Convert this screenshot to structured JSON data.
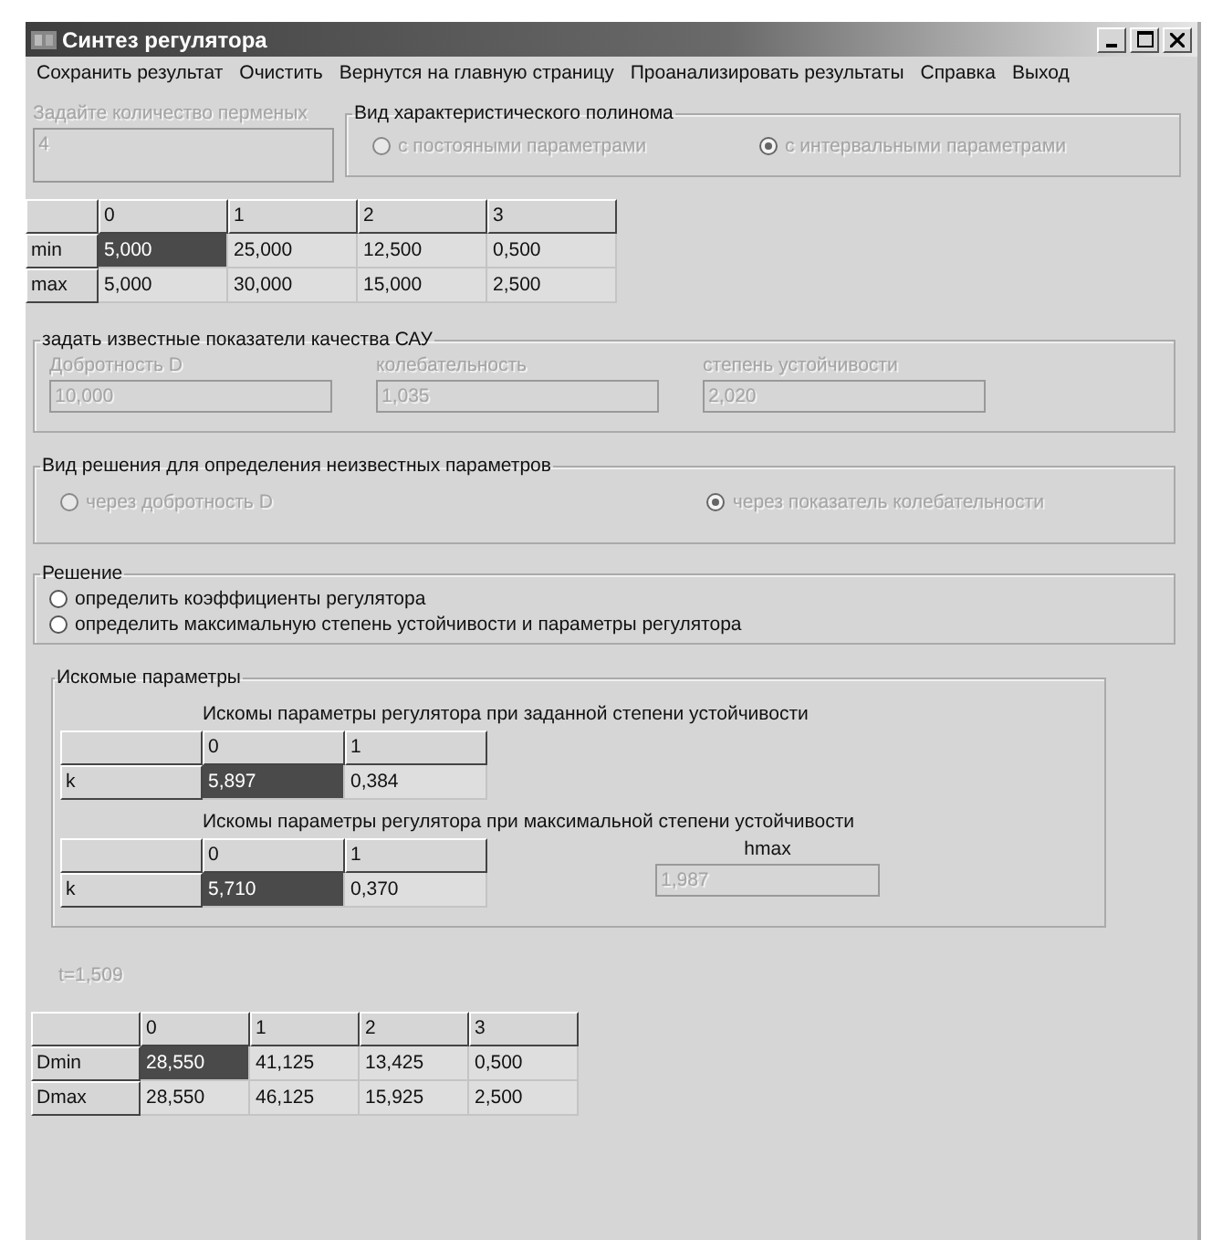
{
  "window": {
    "title": "Синтез регулятора"
  },
  "menu": [
    "Сохранить результат",
    "Очистить",
    "Вернутся на главную страницу",
    "Проанализировать результаты",
    "Справка",
    "Выход"
  ],
  "variable_count": {
    "label": "Задайте количество перменых",
    "value": "4",
    "disabled": true
  },
  "polynomial_type": {
    "title": "Вид характеристического  полинома",
    "options": [
      {
        "label": "с постояными параметрами",
        "selected": false,
        "disabled": true
      },
      {
        "label": "с интервальными параметрами",
        "selected": true,
        "disabled": true
      }
    ]
  },
  "input_table": {
    "columns": [
      "0",
      "1",
      "2",
      "3"
    ],
    "rows": [
      {
        "header": "min",
        "cells": [
          {
            "text": "5,000",
            "selected": true
          },
          {
            "text": "25,000",
            "selected": false
          },
          {
            "text": "12,500",
            "selected": false
          },
          {
            "text": "0,500",
            "selected": false
          }
        ]
      },
      {
        "header": "max",
        "cells": [
          {
            "text": "5,000",
            "selected": false
          },
          {
            "text": "30,000",
            "selected": false
          },
          {
            "text": "15,000",
            "selected": false
          },
          {
            "text": "2,500",
            "selected": false
          }
        ]
      }
    ]
  },
  "quality": {
    "title": "задать известные показатели качества САУ",
    "fields": [
      {
        "label": "Добротность D",
        "value": "10,000",
        "disabled": true
      },
      {
        "label": "колебательность",
        "value": "1,035",
        "disabled": true
      },
      {
        "label": "степень устойчивости",
        "value": "2,020",
        "disabled": true
      }
    ]
  },
  "solution_type": {
    "title": "Вид решения для определения неизвестных параметров",
    "options": [
      {
        "label": "через добротность D",
        "selected": false,
        "disabled": true
      },
      {
        "label": "через показатель колебательности",
        "selected": true,
        "disabled": true
      }
    ]
  },
  "solution": {
    "title": "Решение",
    "options": [
      {
        "label": "определить коэффициенты регулятора",
        "selected": false,
        "disabled": false
      },
      {
        "label": "определить максимальную степень устойчивости и параметры регулятора",
        "selected": false,
        "disabled": false
      }
    ]
  },
  "parameters": {
    "title": "Искомые параметры",
    "tables": [
      {
        "caption": "Искомы параметры регулятора при заданной степени устойчивости",
        "columns": [
          "0",
          "1"
        ],
        "rows": [
          {
            "header": "k",
            "cells": [
              {
                "text": "5,897",
                "selected": true
              },
              {
                "text": "0,384",
                "selected": false
              }
            ]
          }
        ]
      },
      {
        "caption": "Искомы параметры регулятора при максимальной степени устойчивости",
        "columns": [
          "0",
          "1"
        ],
        "rows": [
          {
            "header": "k",
            "cells": [
              {
                "text": "5,710",
                "selected": true
              },
              {
                "text": "0,370",
                "selected": false
              }
            ]
          }
        ],
        "hmax": {
          "label": "hmax",
          "value": "1,987",
          "disabled": true
        }
      }
    ]
  },
  "t_value": {
    "text": "t=1,509",
    "disabled": true
  },
  "result_table": {
    "columns": [
      "0",
      "1",
      "2",
      "3"
    ],
    "rows": [
      {
        "header": "Dmin",
        "cells": [
          {
            "text": "28,550",
            "selected": true
          },
          {
            "text": "41,125",
            "selected": false
          },
          {
            "text": "13,425",
            "selected": false
          },
          {
            "text": "0,500",
            "selected": false
          }
        ]
      },
      {
        "header": "Dmax",
        "cells": [
          {
            "text": "28,550",
            "selected": false
          },
          {
            "text": "46,125",
            "selected": false
          },
          {
            "text": "15,925",
            "selected": false
          },
          {
            "text": "2,500",
            "selected": false
          }
        ]
      }
    ]
  }
}
